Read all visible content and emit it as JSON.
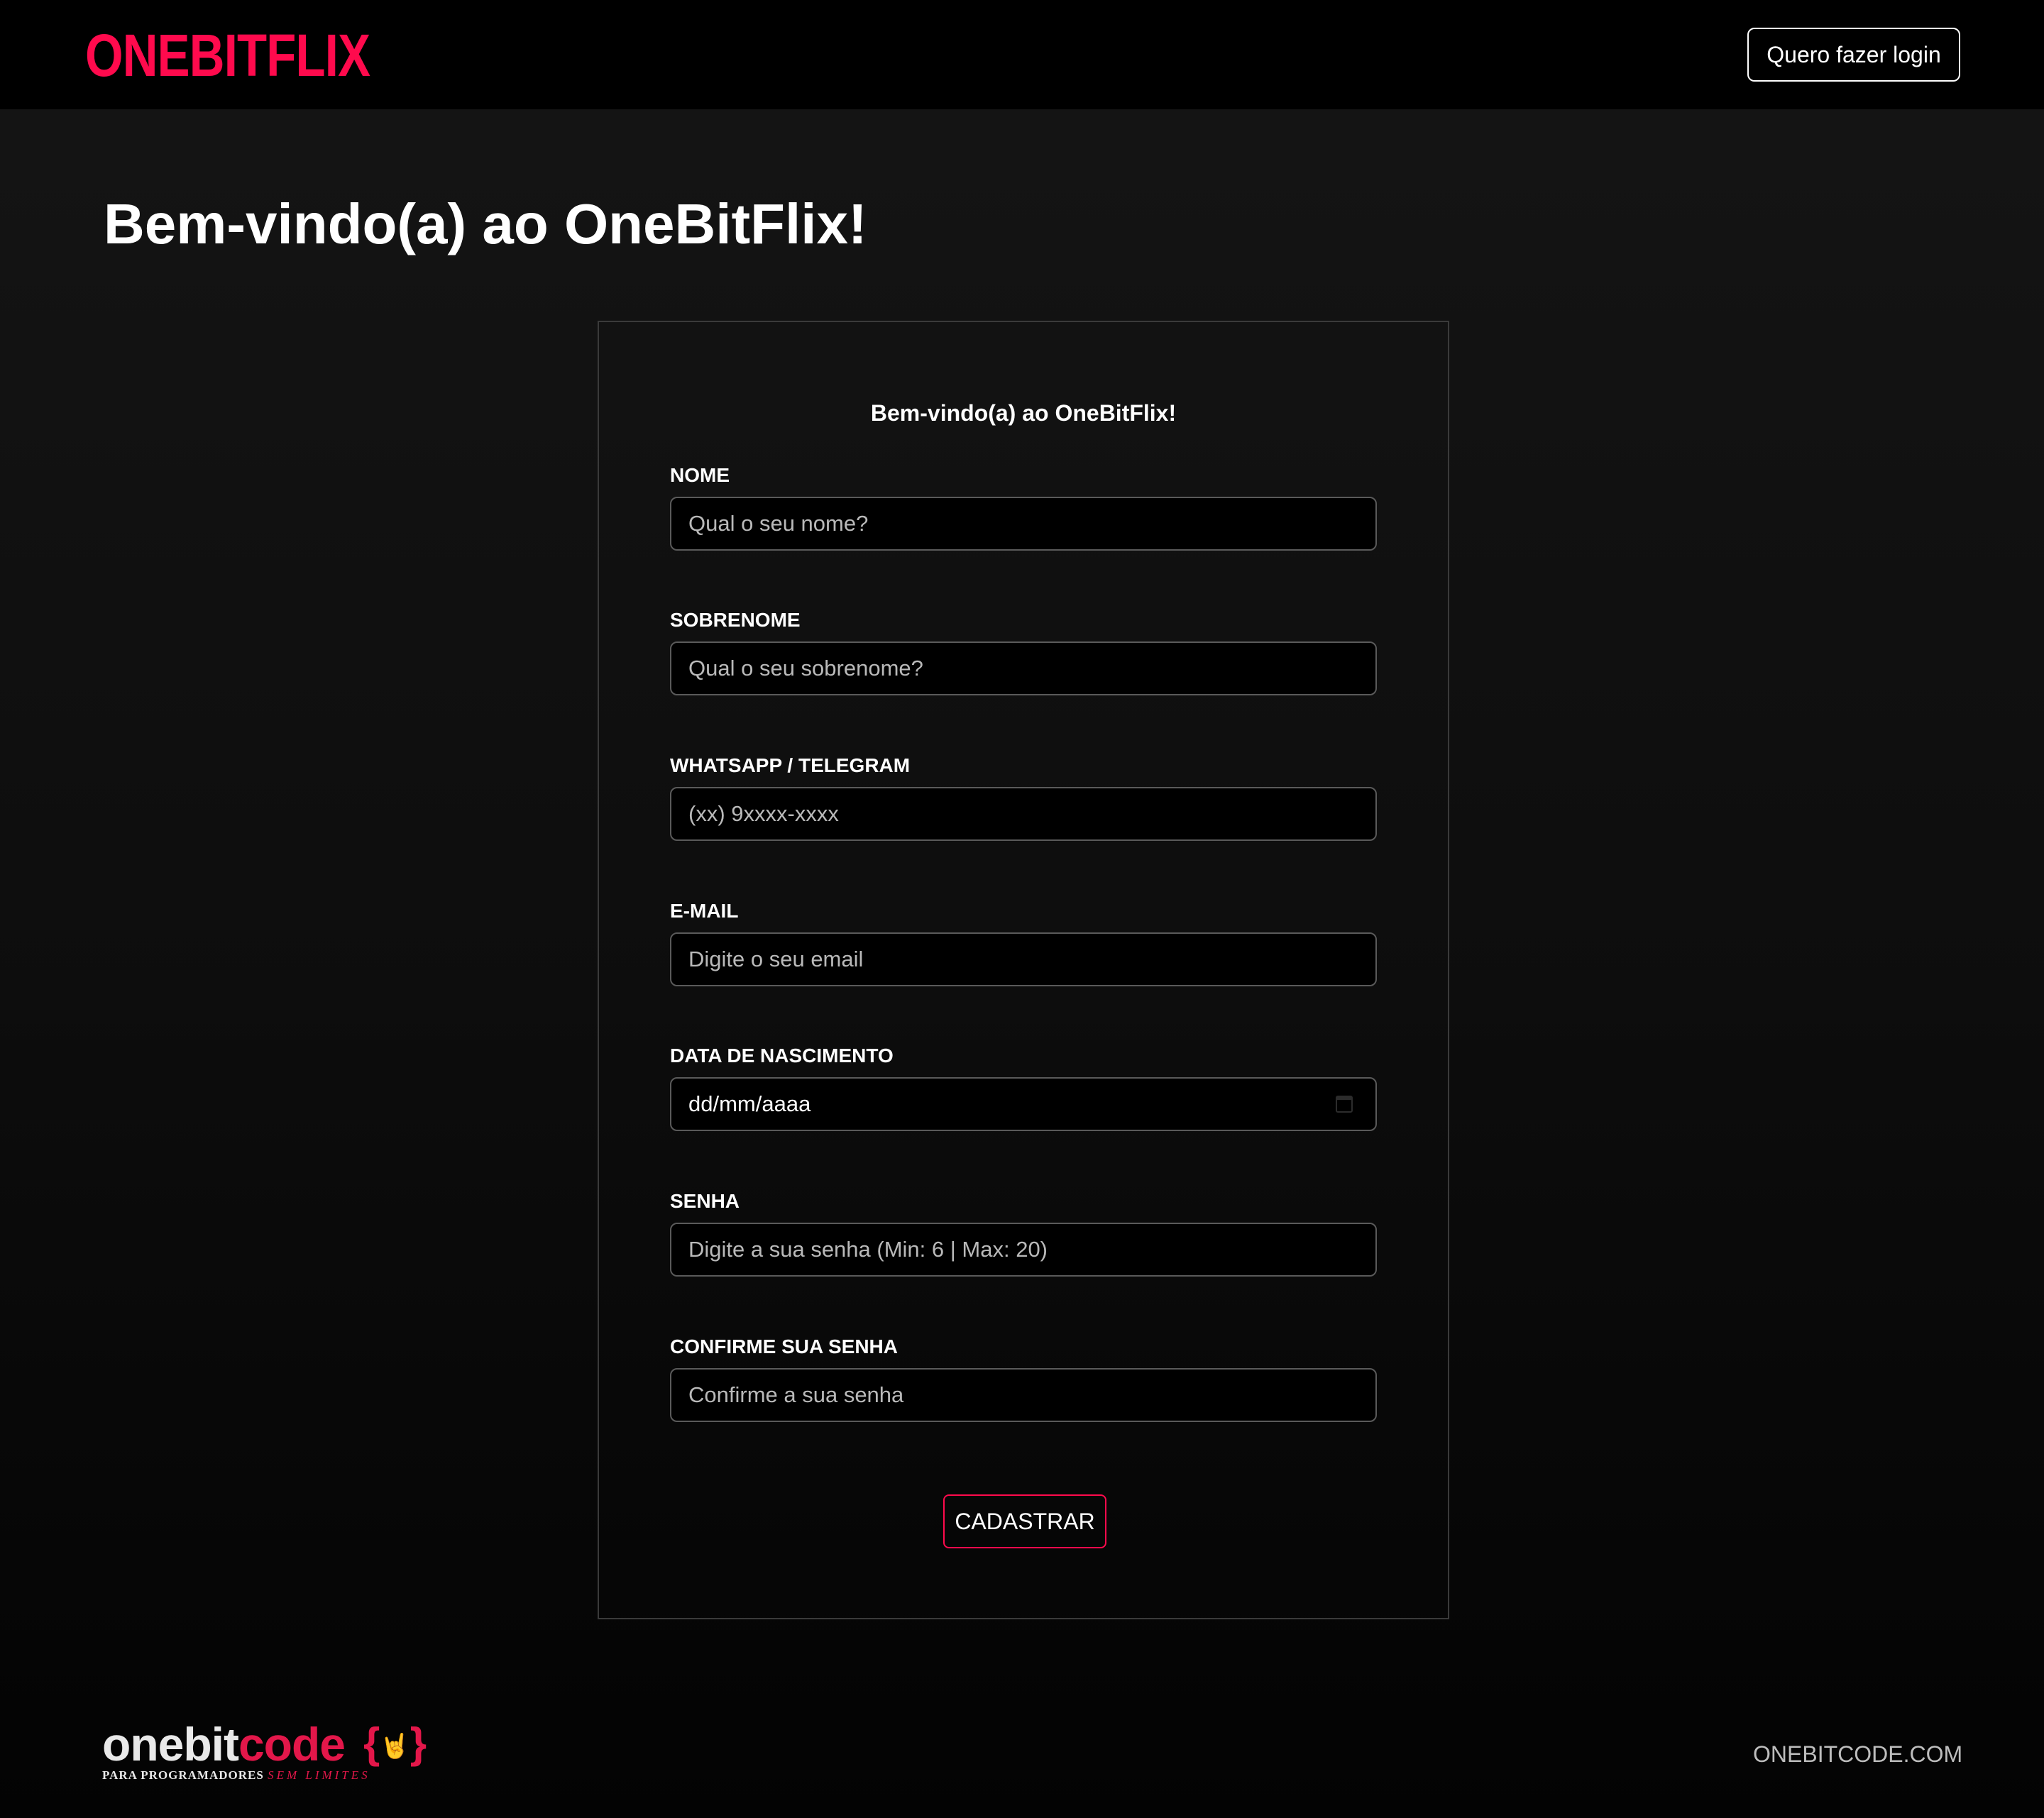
{
  "header": {
    "brand": "ONEBITFLIX",
    "login_label": "Quero fazer login"
  },
  "page": {
    "title": "Bem-vindo(a) ao OneBitFlix!"
  },
  "form": {
    "heading": "Bem-vindo(a) ao OneBitFlix!",
    "fields": {
      "first_name": {
        "label": "NOME",
        "placeholder": "Qual o seu nome?"
      },
      "last_name": {
        "label": "SOBRENOME",
        "placeholder": "Qual o seu sobrenome?"
      },
      "phone": {
        "label": "WHATSAPP / TELEGRAM",
        "placeholder": "(xx) 9xxxx-xxxx"
      },
      "email": {
        "label": "E-MAIL",
        "placeholder": "Digite o seu email"
      },
      "birth_date": {
        "label": "DATA DE NASCIMENTO",
        "placeholder": "dd/mm/aaaa"
      },
      "password": {
        "label": "SENHA",
        "placeholder": "Digite a sua senha (Min: 6 | Max: 20)"
      },
      "password_confirm": {
        "label": "CONFIRME SUA SENHA",
        "placeholder": "Confirme a sua senha"
      }
    },
    "submit_label": "CADASTRAR"
  },
  "footer": {
    "logo": {
      "word_part1": "onebit",
      "word_part2": "code",
      "tagline_part1": "PARA PROGRAMADORES",
      "tagline_part2": "SEM LIMITES"
    },
    "link_label": "ONEBITCODE.COM"
  },
  "colors": {
    "accent": "#ff0a4d",
    "background_top": "#151515",
    "background_bottom": "#030303",
    "header_bg": "#000000"
  },
  "icons": {
    "date_picker": "calendar-icon",
    "footer_logo": "rock-hand-icon"
  }
}
